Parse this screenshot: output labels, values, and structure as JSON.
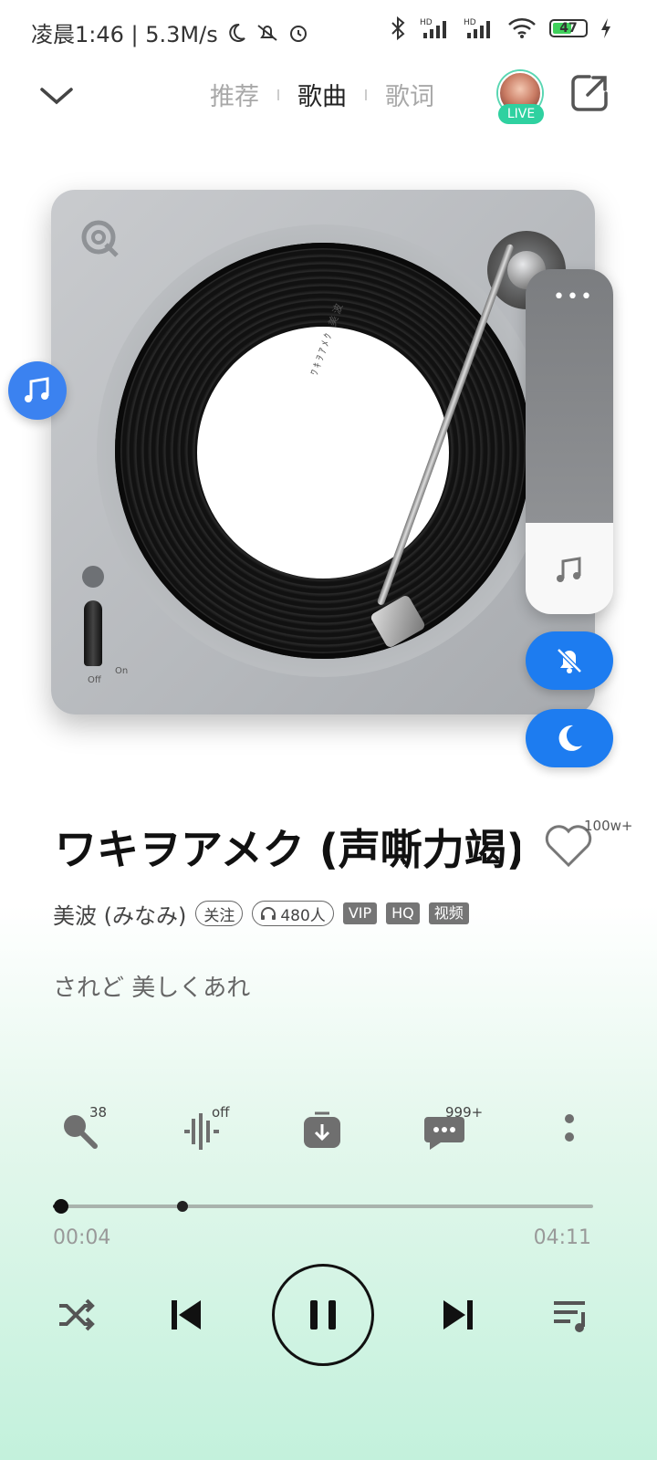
{
  "status": {
    "time_speed": "凌晨1:46 | 5.3M/s",
    "battery": "47"
  },
  "nav": {
    "tabs": [
      "推荐",
      "歌曲",
      "歌词"
    ],
    "active_tab": "歌曲",
    "live_label": "LIVE"
  },
  "turntable": {
    "label_text": "ﾜｷｦｱﾒｸ 美波",
    "off": "Off",
    "on": "On"
  },
  "song": {
    "title": "ワキヲアメク (声嘶力竭)",
    "artist": "美波 (みなみ)",
    "follow": "关注",
    "listeners": "480人",
    "tags": [
      "VIP",
      "HQ",
      "视频"
    ],
    "likes": "100w+",
    "lyric": "されど 美しくあれ"
  },
  "actions": {
    "sing_count": "38",
    "effect_state": "off",
    "comments": "999+"
  },
  "progress": {
    "current": "00:04",
    "total": "04:11",
    "fraction": 0.016,
    "marker_fraction": 0.24
  },
  "colors": {
    "accent_blue": "#1d7cf0",
    "live_green": "#2fd1a0"
  },
  "icons": [
    "back-chevron-icon",
    "share-icon",
    "music-note-icon",
    "more-dots-icon",
    "mute-bell-icon",
    "moon-icon",
    "heart-icon",
    "microphone-icon",
    "sound-effect-icon",
    "download-icon",
    "comment-icon",
    "more-vertical-icon",
    "shuffle-icon",
    "previous-icon",
    "pause-icon",
    "next-icon",
    "playlist-icon"
  ]
}
